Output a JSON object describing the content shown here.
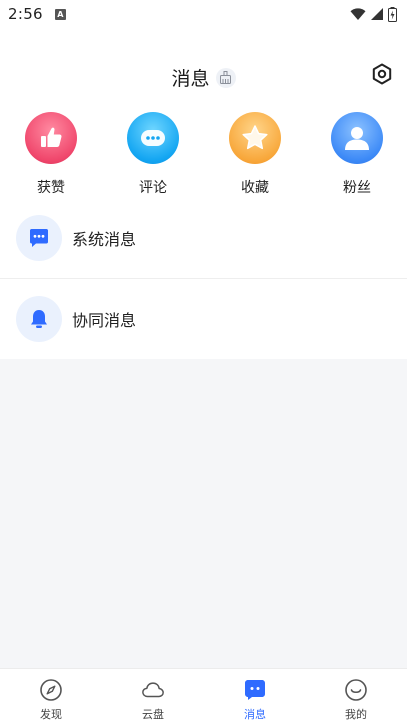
{
  "status_bar": {
    "time": "2:56",
    "a_badge": "A"
  },
  "header": {
    "title": "消息"
  },
  "quick_actions": [
    {
      "label": "获赞",
      "icon": "thumbs-up-icon",
      "color": "#f0476c"
    },
    {
      "label": "评论",
      "icon": "comment-icon",
      "color": "#12a4f0"
    },
    {
      "label": "收藏",
      "icon": "star-icon",
      "color": "#f8a83c"
    },
    {
      "label": "粉丝",
      "icon": "user-icon",
      "color": "#3d8af7"
    }
  ],
  "messages": [
    {
      "label": "系统消息",
      "icon": "chat-bubble-icon"
    },
    {
      "label": "协同消息",
      "icon": "bell-icon"
    }
  ],
  "tabbar": [
    {
      "label": "发现",
      "icon": "compass-icon",
      "active": false
    },
    {
      "label": "云盘",
      "icon": "cloud-icon",
      "active": false
    },
    {
      "label": "消息",
      "icon": "message-icon",
      "active": true
    },
    {
      "label": "我的",
      "icon": "smile-icon",
      "active": false
    }
  ]
}
